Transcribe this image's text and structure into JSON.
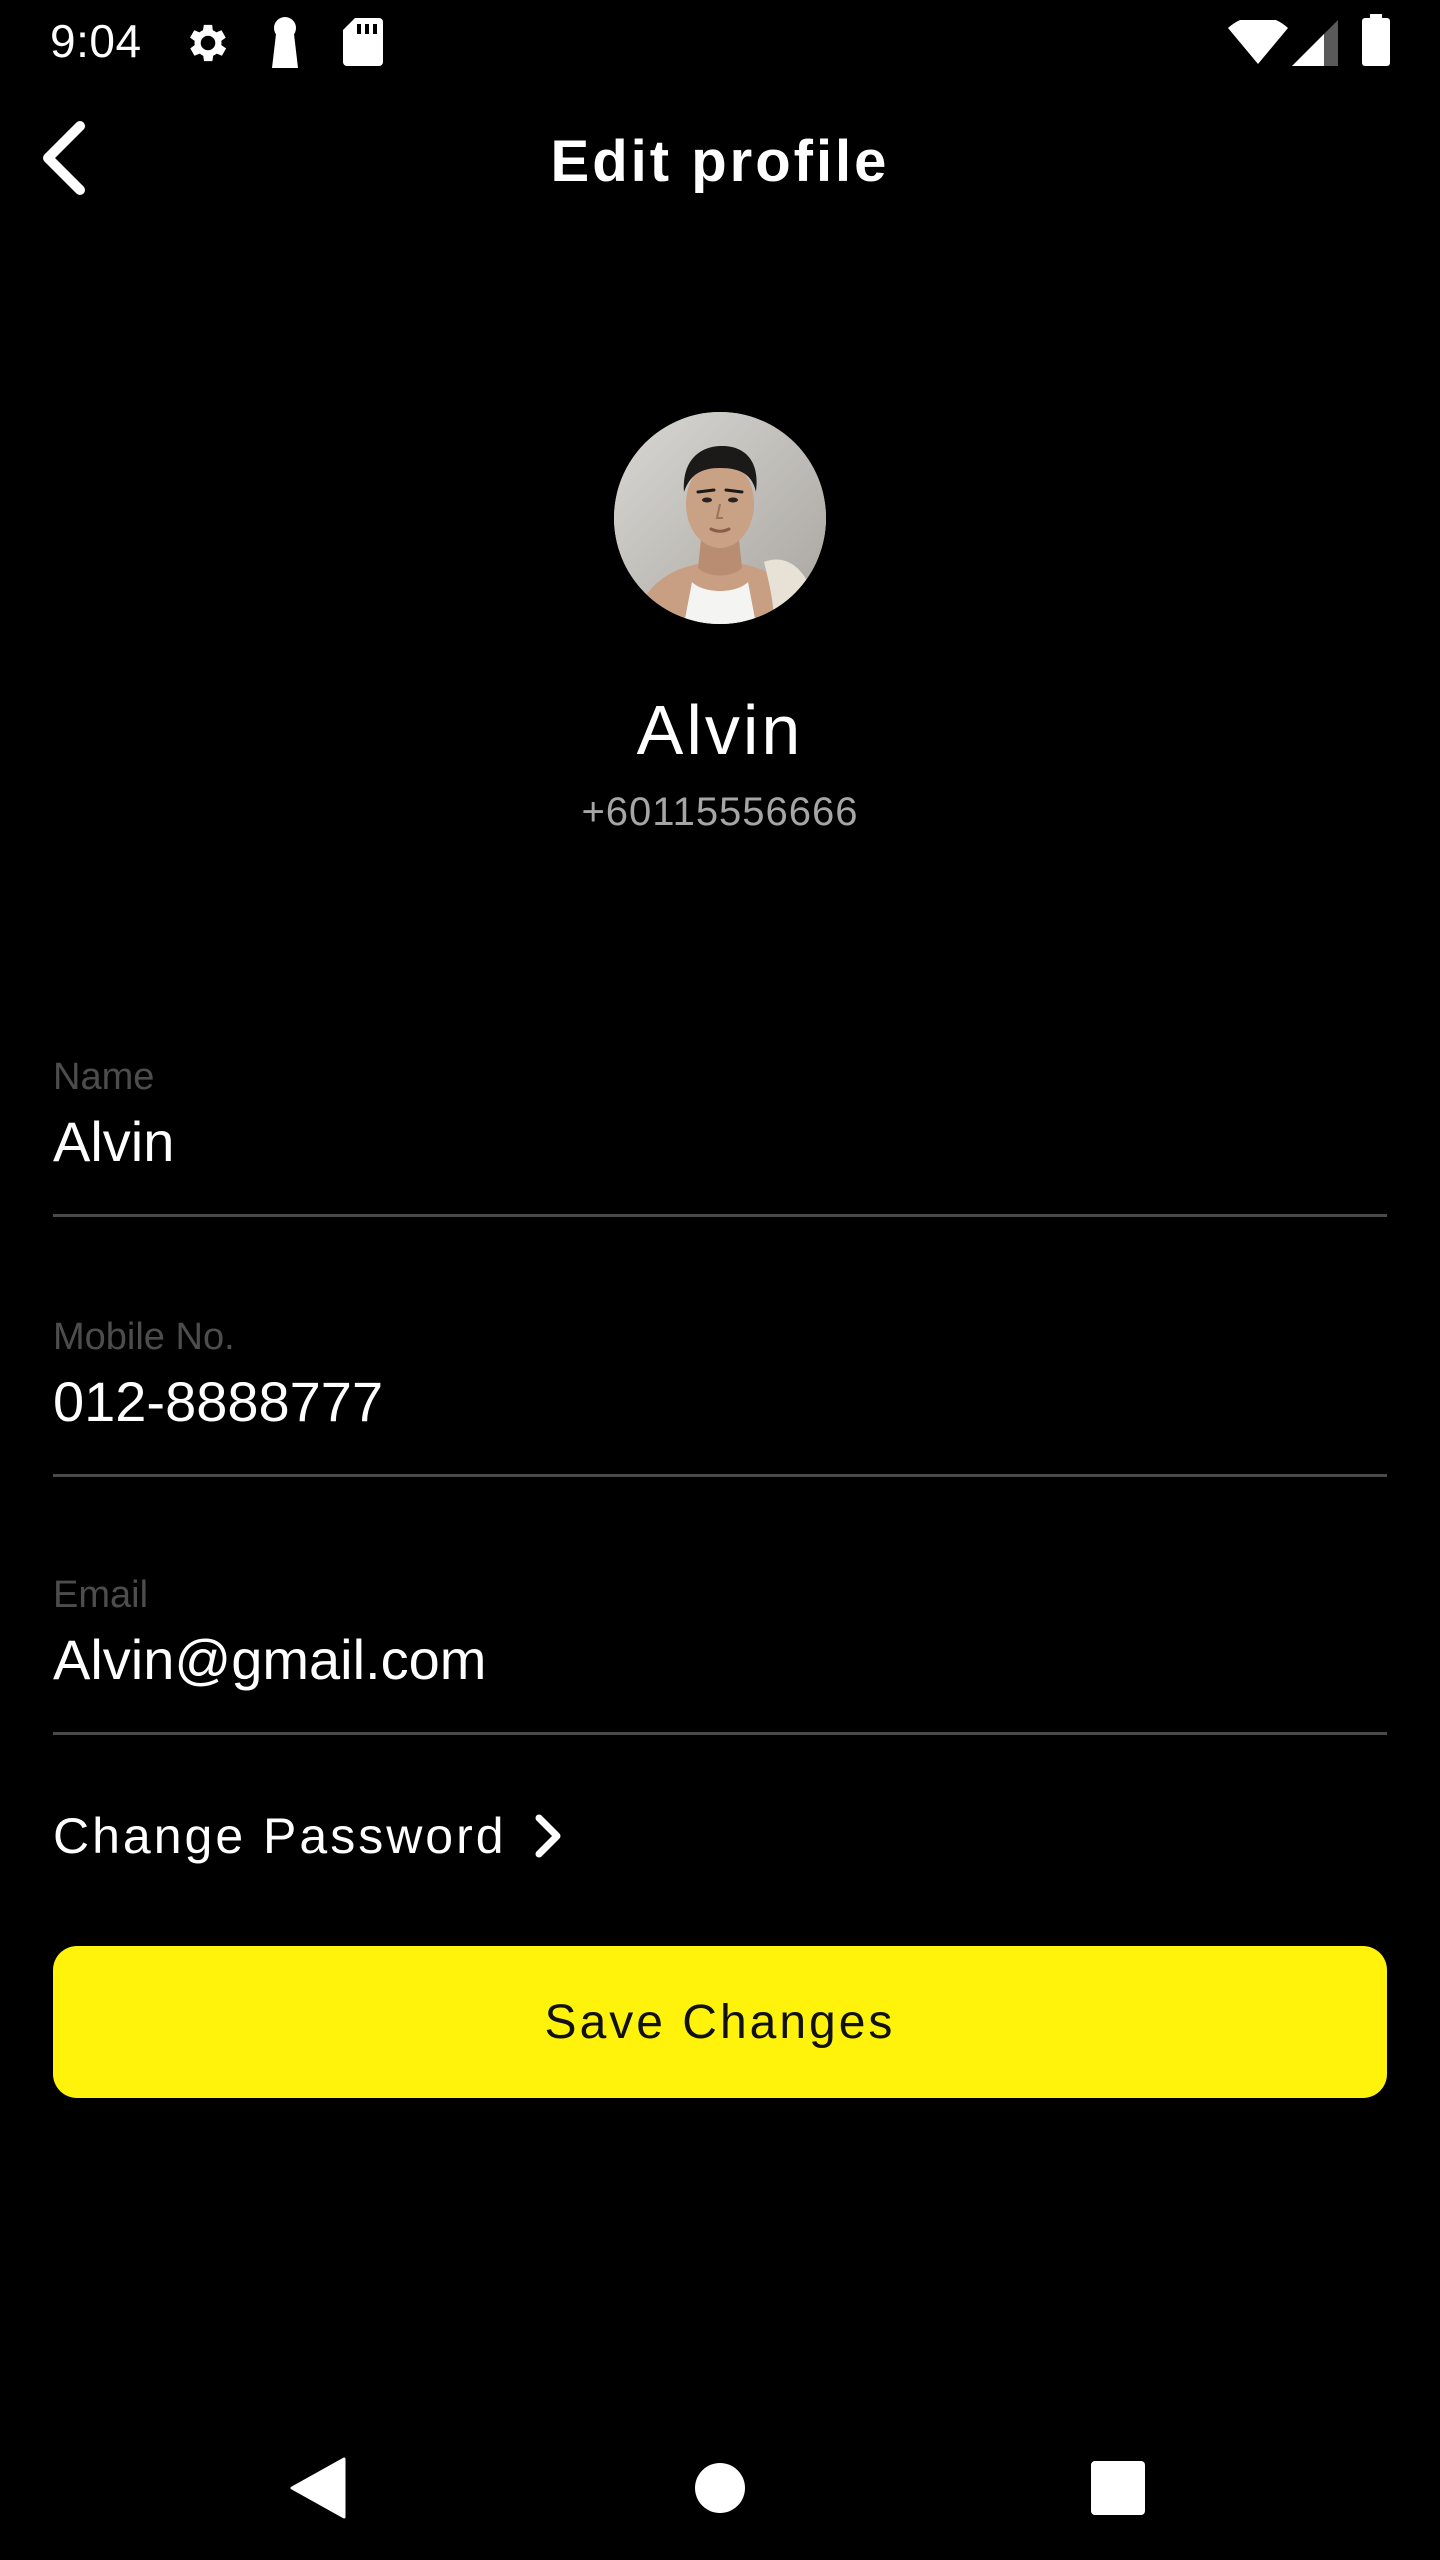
{
  "status_bar": {
    "time": "9:04",
    "left_icons": [
      "gear-icon",
      "keyhole-icon",
      "sd-card-icon"
    ],
    "right_icons": [
      "wifi-icon",
      "cell-signal-icon",
      "battery-icon"
    ]
  },
  "app_bar": {
    "title": "Edit profile",
    "back_icon": "chevron-left-icon"
  },
  "profile": {
    "avatar": "user-avatar-photo",
    "name": "Alvin",
    "phone": "+60115556666"
  },
  "form": {
    "name": {
      "label": "Name",
      "value": "Alvin"
    },
    "mobile": {
      "label": "Mobile No.",
      "value": "012-8888777"
    },
    "email": {
      "label": "Email",
      "value": "Alvin@gmail.com"
    }
  },
  "change_password": {
    "label": "Change Password",
    "icon": "chevron-right-icon"
  },
  "save_button": {
    "label": "Save Changes"
  },
  "nav_bar": {
    "icons": [
      "back-triangle-icon",
      "home-circle-icon",
      "recents-square-icon"
    ]
  },
  "colors": {
    "background": "#000000",
    "accent": "#fff20b",
    "text": "#ffffff",
    "muted_text": "#a6a6a6",
    "label_text": "#4d4d4d",
    "divider": "#4a4a4a"
  }
}
